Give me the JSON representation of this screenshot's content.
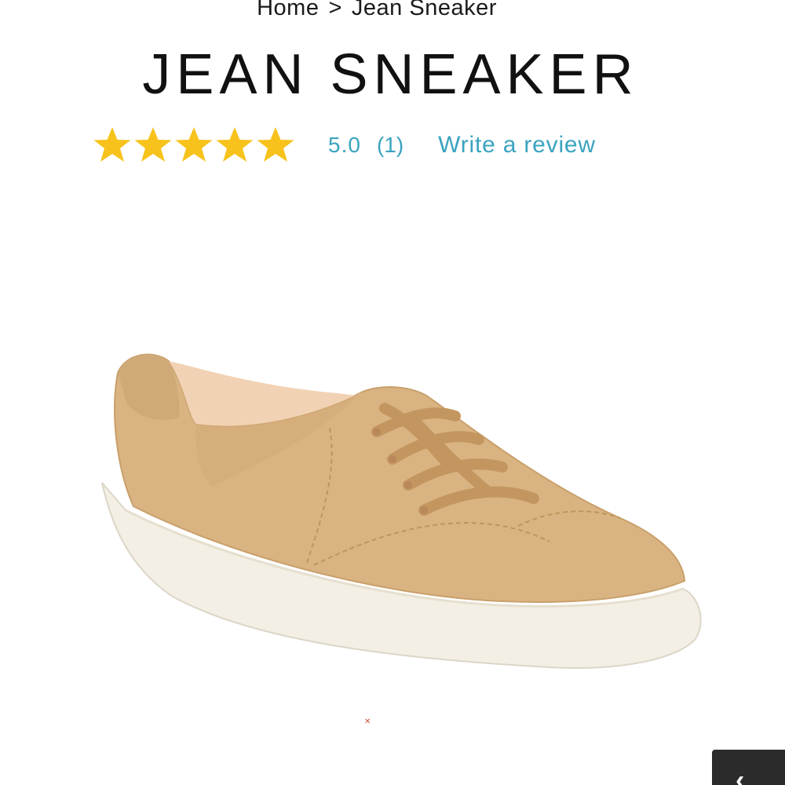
{
  "breadcrumb": {
    "home": "Home",
    "separator": ">",
    "current": "Jean Sneaker"
  },
  "product": {
    "title": "JEAN SNEAKER",
    "image_alt_icon": "sneaker-image"
  },
  "rating": {
    "stars_filled": 5,
    "stars_total": 5,
    "star_color": "#f7c21b",
    "value": "5.0",
    "count": "(1)",
    "write_review": "Write a review",
    "link_color": "#3aa3c0"
  },
  "chat_tab": {
    "icon": "chevron-icon",
    "glyph": "‹"
  }
}
